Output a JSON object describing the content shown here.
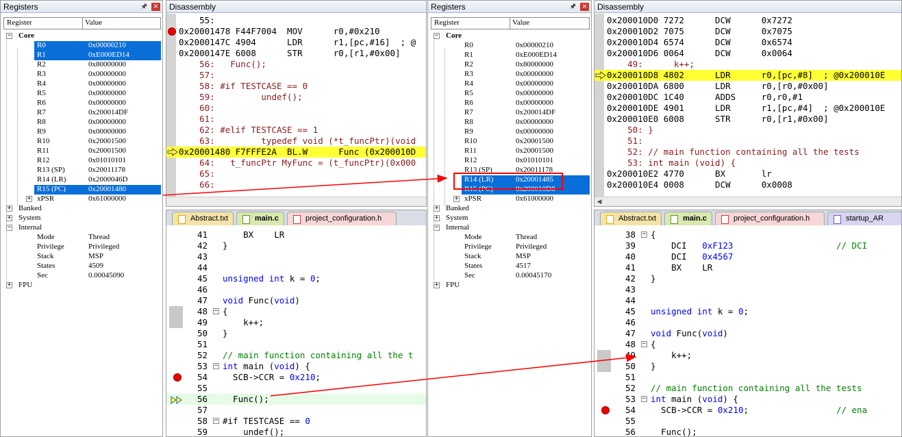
{
  "left": {
    "registers": {
      "title": "Registers",
      "col_register": "Register",
      "col_value": "Value",
      "core_label": "Core",
      "rows": [
        {
          "name": "R0",
          "value": "0x00000210",
          "selected": true
        },
        {
          "name": "R1",
          "value": "0xE000ED14",
          "selected": true
        },
        {
          "name": "R2",
          "value": "0x80000000"
        },
        {
          "name": "R3",
          "value": "0x00000000"
        },
        {
          "name": "R4",
          "value": "0x00000000"
        },
        {
          "name": "R5",
          "value": "0x00000000"
        },
        {
          "name": "R6",
          "value": "0x00000000"
        },
        {
          "name": "R7",
          "value": "0x200014DF"
        },
        {
          "name": "R8",
          "value": "0x00000000"
        },
        {
          "name": "R9",
          "value": "0x00000000"
        },
        {
          "name": "R10",
          "value": "0x20001500"
        },
        {
          "name": "R11",
          "value": "0x20001500"
        },
        {
          "name": "R12",
          "value": "0x01010101"
        },
        {
          "name": "R13 (SP)",
          "value": "0x20011178"
        },
        {
          "name": "R14 (LR)",
          "value": "0x2000046D"
        },
        {
          "name": "R15 (PC)",
          "value": "0x20001480",
          "selected": true
        },
        {
          "name": "xPSR",
          "value": "0x61000000",
          "expander": true
        }
      ],
      "groups": [
        "Banked",
        "System",
        "Internal"
      ],
      "internal": [
        {
          "name": "Mode",
          "value": "Thread"
        },
        {
          "name": "Privilege",
          "value": "Privileged"
        },
        {
          "name": "Stack",
          "value": "MSP"
        },
        {
          "name": "States",
          "value": "4509"
        },
        {
          "name": "Sec",
          "value": "0.00045090"
        }
      ],
      "fpu": "FPU"
    },
    "disassembly": {
      "title": "Disassembly",
      "lines": [
        {
          "text": "    55:"
        },
        {
          "text": "0x20001478 F44F7004  MOV      r0,#0x210",
          "bp": true
        },
        {
          "text": "0x2000147C 4904      LDR      r1,[pc,#16]  ; @"
        },
        {
          "text": "0x2000147E 6008      STR      r0,[r1,#0x00]"
        },
        {
          "text": "    56:   Func();",
          "src": true
        },
        {
          "text": "    57:",
          "src": true
        },
        {
          "text": "    58: #if TESTCASE == 0",
          "src": true
        },
        {
          "text": "    59:         undef();",
          "src": true
        },
        {
          "text": "    60:",
          "src": true
        },
        {
          "text": "    61:",
          "src": true
        },
        {
          "text": "    62: #elif TESTCASE == 1",
          "src": true
        },
        {
          "text": "    63:         typedef void (*t_funcPtr)(void",
          "src": true
        },
        {
          "text": "0x20001480 F7FFFE2A  BL.W      Func (0x200010D",
          "hl": true,
          "arrow": true
        },
        {
          "text": "    64:   t_funcPtr MyFunc = (t_funcPtr)(0x000",
          "src": true
        },
        {
          "text": "    65:",
          "src": true
        },
        {
          "text": "    66:",
          "src": true
        }
      ]
    },
    "editor": {
      "tabs": [
        "Abstract.txt",
        "main.c",
        "project_configuration.h"
      ],
      "active_tab": "main.c",
      "lines": [
        {
          "n": "41",
          "code": "    BX    LR"
        },
        {
          "n": "42",
          "code": "}"
        },
        {
          "n": "43",
          "code": ""
        },
        {
          "n": "44",
          "code": ""
        },
        {
          "n": "45",
          "code": "unsigned int k = 0;"
        },
        {
          "n": "46",
          "code": ""
        },
        {
          "n": "47",
          "code": "void Func(void)"
        },
        {
          "n": "48",
          "code": "{"
        },
        {
          "n": "49",
          "code": "    k++;"
        },
        {
          "n": "50",
          "code": "}"
        },
        {
          "n": "51",
          "code": ""
        },
        {
          "n": "52",
          "code": "// main function containing all the t"
        },
        {
          "n": "53",
          "code": "int main (void) {"
        },
        {
          "n": "54",
          "code": "  SCB->CCR = 0x210;"
        },
        {
          "n": "55",
          "code": ""
        },
        {
          "n": "56",
          "code": "  Func();"
        },
        {
          "n": "57",
          "code": ""
        },
        {
          "n": "58",
          "code": "#if TESTCASE == 0"
        },
        {
          "n": "59",
          "code": "    undef();"
        }
      ]
    }
  },
  "right": {
    "registers": {
      "title": "Registers",
      "col_register": "Register",
      "col_value": "Value",
      "core_label": "Core",
      "rows": [
        {
          "name": "R0",
          "value": "0x00000210"
        },
        {
          "name": "R1",
          "value": "0xE000ED14"
        },
        {
          "name": "R2",
          "value": "0x80000000"
        },
        {
          "name": "R3",
          "value": "0x00000000"
        },
        {
          "name": "R4",
          "value": "0x00000000"
        },
        {
          "name": "R5",
          "value": "0x00000000"
        },
        {
          "name": "R6",
          "value": "0x00000000"
        },
        {
          "name": "R7",
          "value": "0x200014DF"
        },
        {
          "name": "R8",
          "value": "0x00000000"
        },
        {
          "name": "R9",
          "value": "0x00000000"
        },
        {
          "name": "R10",
          "value": "0x20001500"
        },
        {
          "name": "R11",
          "value": "0x20001500"
        },
        {
          "name": "R12",
          "value": "0x01010101"
        },
        {
          "name": "R13 (SP)",
          "value": "0x20011178"
        },
        {
          "name": "R14 (LR)",
          "value": "0x20001485",
          "selected": true
        },
        {
          "name": "R15 (PC)",
          "value": "0x200010D8",
          "selected": true
        },
        {
          "name": "xPSR",
          "value": "0x61000000",
          "expander": true
        }
      ],
      "groups": [
        "Banked",
        "System",
        "Internal"
      ],
      "internal": [
        {
          "name": "Mode",
          "value": "Thread"
        },
        {
          "name": "Privilege",
          "value": "Privileged"
        },
        {
          "name": "Stack",
          "value": "MSP"
        },
        {
          "name": "States",
          "value": "4517"
        },
        {
          "name": "Sec",
          "value": "0.00045170"
        }
      ],
      "fpu": "FPU"
    },
    "disassembly": {
      "title": "Disassembly",
      "lines": [
        {
          "text": "0x200010D0 7272      DCW      0x7272"
        },
        {
          "text": "0x200010D2 7075      DCW      0x7075"
        },
        {
          "text": "0x200010D4 6574      DCW      0x6574"
        },
        {
          "text": "0x200010D6 0064      DCW      0x0064"
        },
        {
          "text": "    49:      k++;",
          "src": true
        },
        {
          "text": "0x200010D8 4802      LDR      r0,[pc,#8]  ; @0x200010E",
          "hl": true,
          "arrow": true
        },
        {
          "text": "0x200010DA 6800      LDR      r0,[r0,#0x00]"
        },
        {
          "text": "0x200010DC 1C40      ADDS     r0,r0,#1"
        },
        {
          "text": "0x200010DE 4901      LDR      r1,[pc,#4]  ; @0x200010E"
        },
        {
          "text": "0x200010E0 6008      STR      r0,[r1,#0x00]"
        },
        {
          "text": "    50: }",
          "src": true
        },
        {
          "text": "    51:",
          "src": true
        },
        {
          "text": "    52: // main function containing all the tests",
          "src": true
        },
        {
          "text": "    53: int main (void) {",
          "src": true
        },
        {
          "text": "0x200010E2 4770      BX       lr"
        },
        {
          "text": "0x200010E4 0008      DCW      0x0008"
        }
      ]
    },
    "editor": {
      "tabs": [
        "Abstract.txt",
        "main.c",
        "project_configuration.h",
        "startup_AR"
      ],
      "active_tab": "main.c",
      "lines": [
        {
          "n": "38",
          "code": "{"
        },
        {
          "n": "39",
          "code": "    DCI   0xF123                    // DCI"
        },
        {
          "n": "40",
          "code": "    DCI   0x4567"
        },
        {
          "n": "41",
          "code": "    BX    LR"
        },
        {
          "n": "42",
          "code": "}"
        },
        {
          "n": "43",
          "code": ""
        },
        {
          "n": "44",
          "code": ""
        },
        {
          "n": "45",
          "code": "unsigned int k = 0;"
        },
        {
          "n": "46",
          "code": ""
        },
        {
          "n": "47",
          "code": "void Func(void)"
        },
        {
          "n": "48",
          "code": "{"
        },
        {
          "n": "49",
          "code": "    k++;"
        },
        {
          "n": "50",
          "code": "}"
        },
        {
          "n": "51",
          "code": ""
        },
        {
          "n": "52",
          "code": "// main function containing all the tests"
        },
        {
          "n": "53",
          "code": "int main (void) {"
        },
        {
          "n": "54",
          "code": "  SCB->CCR = 0x210;                 // ena"
        },
        {
          "n": "55",
          "code": ""
        },
        {
          "n": "56",
          "code": "  Func();"
        }
      ]
    }
  },
  "colors": {
    "selection": "#0a6ed8",
    "current_line": "#ffff33",
    "annotation": "#ff0000"
  }
}
